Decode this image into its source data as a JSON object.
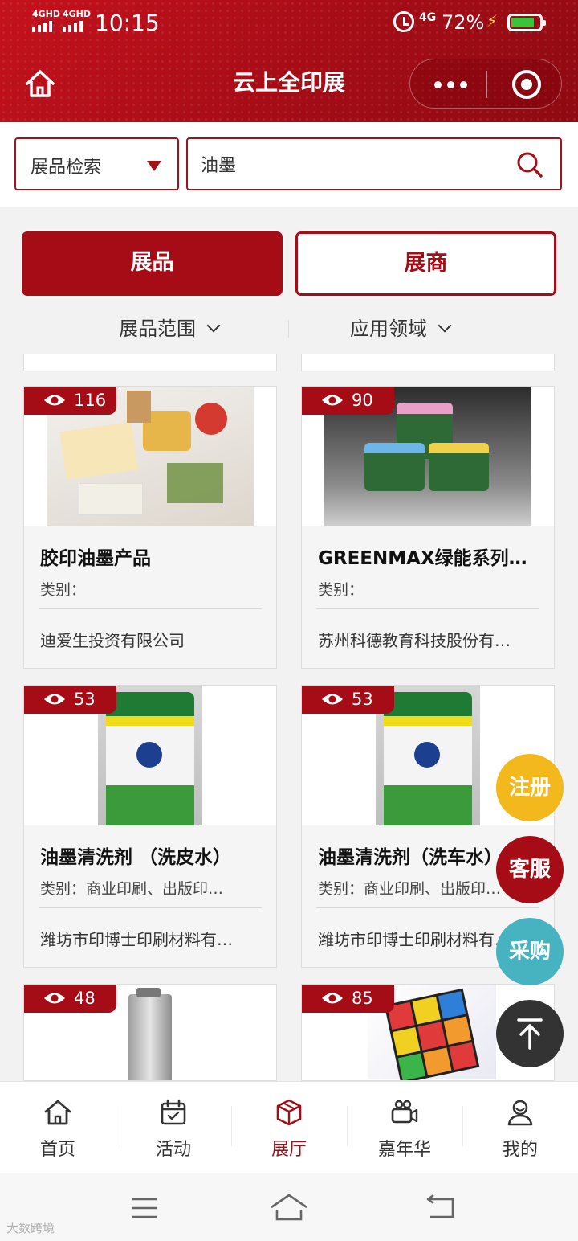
{
  "status_bar": {
    "signal_1": "4GHD",
    "signal_2": "4GHD",
    "time": "10:15",
    "network": "4G",
    "battery": "72%"
  },
  "header": {
    "title": "云上全印展"
  },
  "search": {
    "type_label": "展品检索",
    "query": "油墨"
  },
  "tabs": [
    {
      "label": "展品",
      "active": true
    },
    {
      "label": "展商",
      "active": false
    }
  ],
  "filters": [
    {
      "label": "展品范围"
    },
    {
      "label": "应用领域"
    }
  ],
  "products": [
    {
      "views": "116",
      "title": "胶印油墨产品",
      "category": "类别：",
      "company": "迪爱生投资有限公司",
      "image": "food-packaging"
    },
    {
      "views": "90",
      "title": "GREENMAX绿能系列…",
      "category": "类别：",
      "company": "苏州科德教育科技股份有…",
      "image": "ink-cans"
    },
    {
      "views": "53",
      "title": "油墨清洗剂 （洗皮水）",
      "category": "类别：商业印刷、出版印…",
      "company": "潍坊市印博士印刷材料有…",
      "image": "cleaner-can"
    },
    {
      "views": "53",
      "title": "油墨清洗剂（洗车水）",
      "category": "类别：商业印刷、出版印…",
      "company": "潍坊市印博士印刷材料有…",
      "image": "cleaner-can"
    },
    {
      "views": "48",
      "image": "machine"
    },
    {
      "views": "85",
      "image": "rubik-cube"
    }
  ],
  "floating_buttons": {
    "register": "注册",
    "service": "客服",
    "purchase": "采购"
  },
  "tabbar": [
    {
      "label": "首页",
      "icon": "home-icon",
      "active": false
    },
    {
      "label": "活动",
      "icon": "calendar-icon",
      "active": false
    },
    {
      "label": "展厅",
      "icon": "cube-icon",
      "active": true
    },
    {
      "label": "嘉年华",
      "icon": "camera-icon",
      "active": false
    },
    {
      "label": "我的",
      "icon": "user-icon",
      "active": false
    }
  ],
  "colors": {
    "brand_red": "#a50c16",
    "register_yellow": "#f3b81c",
    "purchase_teal": "#47b2c0"
  },
  "watermark": "大数跨境"
}
